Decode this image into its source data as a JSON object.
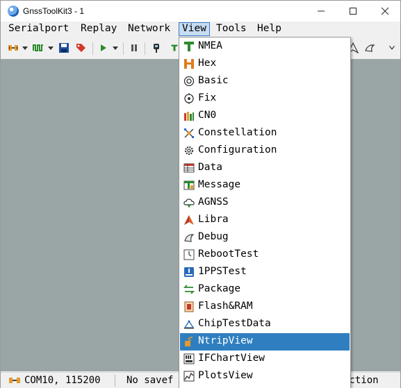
{
  "window": {
    "title": "GnssToolKit3 - 1"
  },
  "menubar": {
    "serialport": "Serialport",
    "replay": "Replay",
    "network": "Network",
    "view": "View",
    "tools": "Tools",
    "help": "Help"
  },
  "view_menu": {
    "items": [
      {
        "label": "NMEA",
        "icon": "nmea-icon"
      },
      {
        "label": "Hex",
        "icon": "hex-icon"
      },
      {
        "label": "Basic",
        "icon": "basic-icon"
      },
      {
        "label": "Fix",
        "icon": "fix-icon"
      },
      {
        "label": "CN0",
        "icon": "cn0-bars-icon"
      },
      {
        "label": "Constellation",
        "icon": "constellation-icon"
      },
      {
        "label": "Configuration",
        "icon": "configuration-gear-icon"
      },
      {
        "label": "Data",
        "icon": "data-table-icon"
      },
      {
        "label": "Message",
        "icon": "message-icon"
      },
      {
        "label": "AGNSS",
        "icon": "agnss-cloud-icon"
      },
      {
        "label": "Libra",
        "icon": "libra-icon"
      },
      {
        "label": "Debug",
        "icon": "debug-bird-icon"
      },
      {
        "label": "RebootTest",
        "icon": "reboot-clock-icon"
      },
      {
        "label": "1PPSTest",
        "icon": "pps-icon"
      },
      {
        "label": "Package",
        "icon": "package-arrows-icon"
      },
      {
        "label": "Flash&RAM",
        "icon": "flash-ram-icon"
      },
      {
        "label": "ChipTestData",
        "icon": "chip-test-icon"
      },
      {
        "label": "NtripView",
        "icon": "ntrip-icon"
      },
      {
        "label": "IFChartView",
        "icon": "ifchart-icon"
      },
      {
        "label": "PlotsView",
        "icon": "plots-icon"
      }
    ],
    "highlighted": "NtripView"
  },
  "statusbar": {
    "port": "COM10, 115200",
    "save": "No savef",
    "connection": "ection"
  },
  "colors": {
    "workarea": "#9aa6a6",
    "highlight": "#2f7fc0",
    "menu_active": "#c6dcf1"
  }
}
